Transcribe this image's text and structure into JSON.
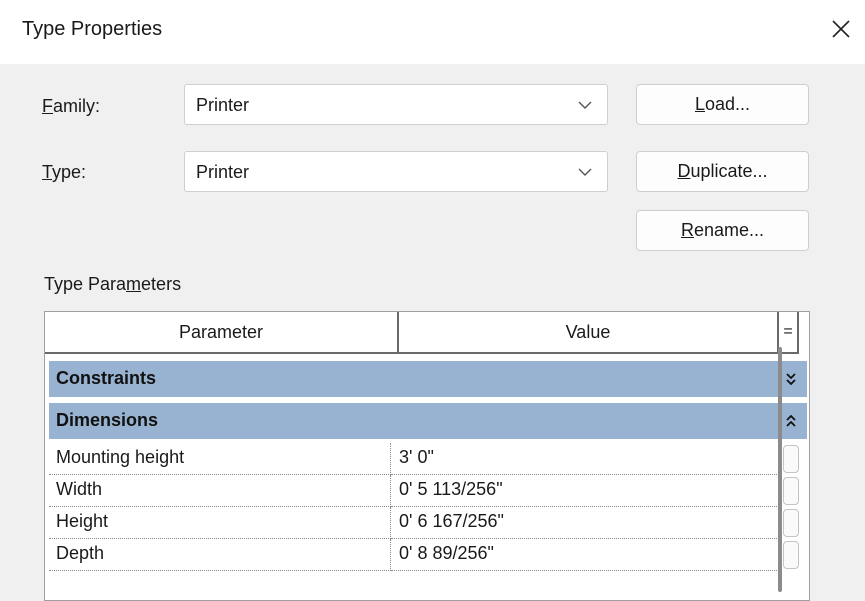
{
  "dialog": {
    "title": "Type Properties"
  },
  "family": {
    "label_key": "F",
    "label_rest": "amily:",
    "value": "Printer"
  },
  "type": {
    "label_key": "T",
    "label_rest": "ype:",
    "value": "Printer"
  },
  "buttons": {
    "load_key": "L",
    "load_rest": "oad...",
    "duplicate_key": "D",
    "duplicate_rest": "uplicate...",
    "rename_key": "R",
    "rename_rest": "ename..."
  },
  "section": {
    "pre": "Type Para",
    "key": "m",
    "post": "eters"
  },
  "table": {
    "headers": {
      "parameter": "Parameter",
      "value": "Value",
      "edit": "="
    },
    "groups": [
      {
        "name": "Constraints",
        "state_icon": "expand-double-chevron-icon"
      },
      {
        "name": "Dimensions",
        "state_icon": "collapse-double-chevron-icon"
      }
    ],
    "rows": [
      {
        "param": "Mounting height",
        "value": "3'  0\""
      },
      {
        "param": "Width",
        "value": "0'  5 113/256\""
      },
      {
        "param": "Height",
        "value": "0'  6 167/256\""
      },
      {
        "param": "Depth",
        "value": "0'  8 89/256\""
      }
    ]
  },
  "colors": {
    "group_header": "#98b3d1",
    "background": "#f0f0f0"
  }
}
